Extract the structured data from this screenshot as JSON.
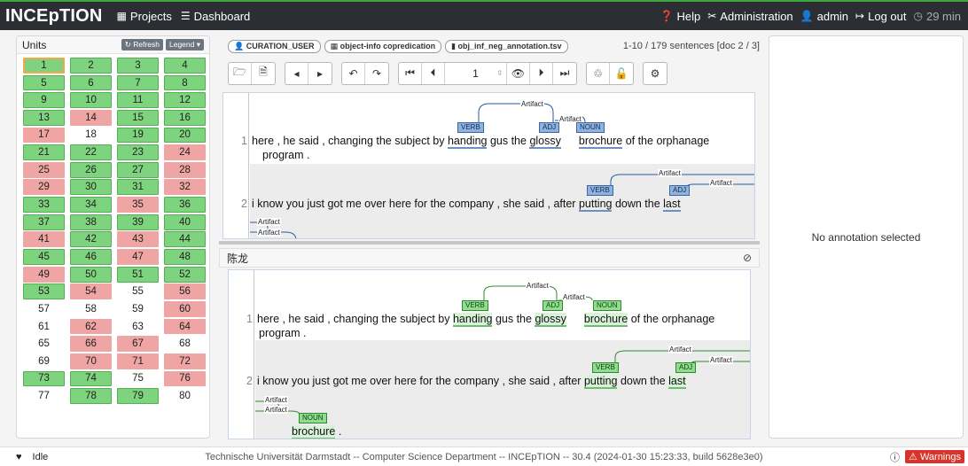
{
  "navbar": {
    "brand": "INCEpTION",
    "projects": "Projects",
    "dashboard": "Dashboard",
    "help": "Help",
    "administration": "Administration",
    "user": "admin",
    "logout": "Log out",
    "timer": "29 min"
  },
  "units": {
    "title": "Units",
    "refresh": "Refresh",
    "legend": "Legend",
    "items": [
      {
        "n": "1",
        "s": "green",
        "sel": true
      },
      {
        "n": "2",
        "s": "green"
      },
      {
        "n": "3",
        "s": "green"
      },
      {
        "n": "4",
        "s": "green"
      },
      {
        "n": "5",
        "s": "green"
      },
      {
        "n": "6",
        "s": "green"
      },
      {
        "n": "7",
        "s": "green"
      },
      {
        "n": "8",
        "s": "green"
      },
      {
        "n": "9",
        "s": "green"
      },
      {
        "n": "10",
        "s": "green"
      },
      {
        "n": "11",
        "s": "green"
      },
      {
        "n": "12",
        "s": "green"
      },
      {
        "n": "13",
        "s": "green"
      },
      {
        "n": "14",
        "s": "red"
      },
      {
        "n": "15",
        "s": "green"
      },
      {
        "n": "16",
        "s": "green"
      },
      {
        "n": "17",
        "s": "red"
      },
      {
        "n": "18",
        "s": "white"
      },
      {
        "n": "19",
        "s": "green"
      },
      {
        "n": "20",
        "s": "green"
      },
      {
        "n": "21",
        "s": "green"
      },
      {
        "n": "22",
        "s": "green"
      },
      {
        "n": "23",
        "s": "green"
      },
      {
        "n": "24",
        "s": "red"
      },
      {
        "n": "25",
        "s": "red"
      },
      {
        "n": "26",
        "s": "green"
      },
      {
        "n": "27",
        "s": "green"
      },
      {
        "n": "28",
        "s": "red"
      },
      {
        "n": "29",
        "s": "red"
      },
      {
        "n": "30",
        "s": "green"
      },
      {
        "n": "31",
        "s": "green"
      },
      {
        "n": "32",
        "s": "red"
      },
      {
        "n": "33",
        "s": "green"
      },
      {
        "n": "34",
        "s": "green"
      },
      {
        "n": "35",
        "s": "red"
      },
      {
        "n": "36",
        "s": "green"
      },
      {
        "n": "37",
        "s": "green"
      },
      {
        "n": "38",
        "s": "green"
      },
      {
        "n": "39",
        "s": "green"
      },
      {
        "n": "40",
        "s": "green"
      },
      {
        "n": "41",
        "s": "red"
      },
      {
        "n": "42",
        "s": "green"
      },
      {
        "n": "43",
        "s": "red"
      },
      {
        "n": "44",
        "s": "green"
      },
      {
        "n": "45",
        "s": "green"
      },
      {
        "n": "46",
        "s": "green"
      },
      {
        "n": "47",
        "s": "red"
      },
      {
        "n": "48",
        "s": "green"
      },
      {
        "n": "49",
        "s": "red"
      },
      {
        "n": "50",
        "s": "green"
      },
      {
        "n": "51",
        "s": "green"
      },
      {
        "n": "52",
        "s": "green"
      },
      {
        "n": "53",
        "s": "green"
      },
      {
        "n": "54",
        "s": "red"
      },
      {
        "n": "55",
        "s": "white"
      },
      {
        "n": "56",
        "s": "red"
      },
      {
        "n": "57",
        "s": "white"
      },
      {
        "n": "58",
        "s": "white"
      },
      {
        "n": "59",
        "s": "white"
      },
      {
        "n": "60",
        "s": "red"
      },
      {
        "n": "61",
        "s": "white"
      },
      {
        "n": "62",
        "s": "red"
      },
      {
        "n": "63",
        "s": "white"
      },
      {
        "n": "64",
        "s": "red"
      },
      {
        "n": "65",
        "s": "white"
      },
      {
        "n": "66",
        "s": "red"
      },
      {
        "n": "67",
        "s": "red"
      },
      {
        "n": "68",
        "s": "white"
      },
      {
        "n": "69",
        "s": "white"
      },
      {
        "n": "70",
        "s": "red"
      },
      {
        "n": "71",
        "s": "red"
      },
      {
        "n": "72",
        "s": "red"
      },
      {
        "n": "73",
        "s": "green"
      },
      {
        "n": "74",
        "s": "green"
      },
      {
        "n": "75",
        "s": "white"
      },
      {
        "n": "76",
        "s": "red"
      },
      {
        "n": "77",
        "s": "white"
      },
      {
        "n": "78",
        "s": "green"
      },
      {
        "n": "79",
        "s": "green"
      },
      {
        "n": "80",
        "s": "white"
      }
    ]
  },
  "header": {
    "user_pill": "CURATION_USER",
    "project_pill": "object-info copredication",
    "doc_pill": "obj_inf_neg_annotation.tsv",
    "sentence_count": "1-10 / 179 sentences [doc 2 / 3]"
  },
  "toolbar": {
    "page_value": "1"
  },
  "annotations": {
    "verb": "VERB",
    "adj": "ADJ",
    "noun": "NOUN",
    "relation": "Artifact"
  },
  "sentences": {
    "s1_num": "1",
    "s1_pre": "here , he said , changing the subject by ",
    "s1_tok1": "handing",
    "s1_mid": " gus the ",
    "s1_tok2": "glossy",
    "s1_gap": "  ",
    "s1_tok3": "brochure",
    "s1_post": " of the orphanage",
    "s1_line2": "program .",
    "s2_num": "2",
    "s2_pre": "i know you just got me over here for the company , she said , after ",
    "s2_tok1": "putting",
    "s2_mid": " down the ",
    "s2_tok2": "last",
    "s2_line2_tok": "brochure",
    "s2_line2_post": " ."
  },
  "curator": {
    "name": "陈龙"
  },
  "detail": {
    "empty_text": "No annotation selected"
  },
  "footer": {
    "status": "Idle",
    "text": "Technische Universität Darmstadt -- Computer Science Department -- INCEpTION -- 30.4 (2024-01-30 15:23:33, build 5628e3e0)",
    "warnings": "Warnings"
  }
}
